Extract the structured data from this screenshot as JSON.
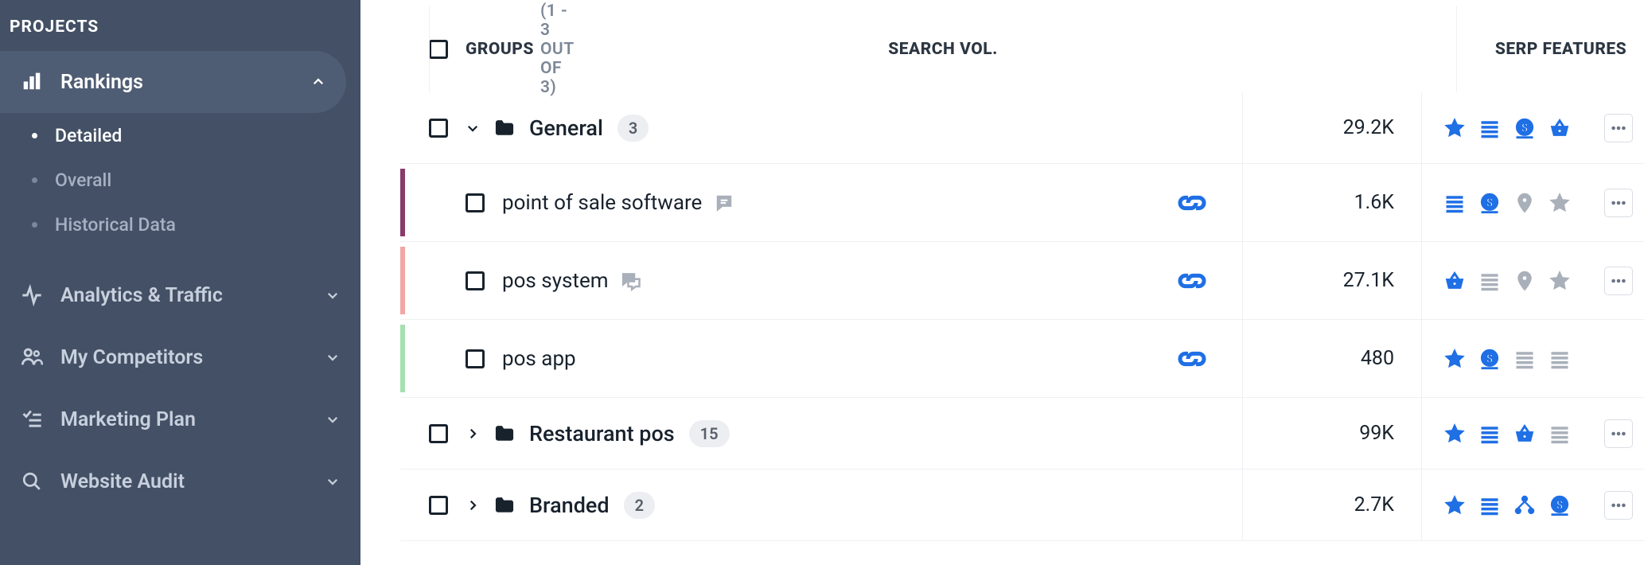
{
  "sidebar": {
    "heading": "PROJECTS",
    "items": [
      {
        "label": "Rankings",
        "sub": [
          {
            "label": "Detailed"
          },
          {
            "label": "Overall"
          },
          {
            "label": "Historical Data"
          }
        ]
      },
      {
        "label": "Analytics & Traffic"
      },
      {
        "label": "My Competitors"
      },
      {
        "label": "Marketing Plan"
      },
      {
        "label": "Website Audit"
      }
    ]
  },
  "table": {
    "header": {
      "groups_label": "GROUPS",
      "groups_count": "(1 - 3 OUT OF 3)",
      "vol_label": "SEARCH VOL.",
      "feat_label": "SERP FEATURES"
    },
    "groups": [
      {
        "name": "General",
        "count": "3",
        "vol": "29.2K",
        "keywords": [
          {
            "name": "point of sale software",
            "vol": "1.6K"
          },
          {
            "name": "pos system",
            "vol": "27.1K"
          },
          {
            "name": "pos app",
            "vol": "480"
          }
        ]
      },
      {
        "name": "Restaurant pos",
        "count": "15",
        "vol": "99K"
      },
      {
        "name": "Branded",
        "count": "2",
        "vol": "2.7K"
      }
    ]
  }
}
